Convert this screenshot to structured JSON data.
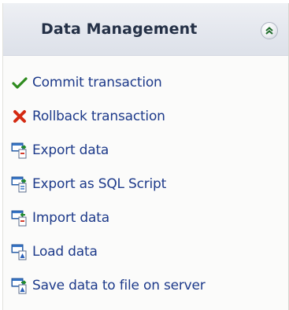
{
  "panel": {
    "title": "Data Management",
    "collapse_icon": "double-chevron-up-icon"
  },
  "items": [
    {
      "label": "Commit transaction",
      "icon": "checkmark-icon",
      "color": "#2e8b1e"
    },
    {
      "label": "Rollback transaction",
      "icon": "red-x-icon",
      "color": "#d42a12"
    },
    {
      "label": "Export data",
      "icon": "export-data-icon"
    },
    {
      "label": "Export as SQL Script",
      "icon": "export-sql-icon"
    },
    {
      "label": "Import data",
      "icon": "import-data-icon"
    },
    {
      "label": "Load data",
      "icon": "load-data-icon"
    },
    {
      "label": "Save data to file on server",
      "icon": "save-to-server-icon"
    }
  ],
  "colors": {
    "link_text": "#1d3a8a",
    "header_text": "#243046"
  }
}
